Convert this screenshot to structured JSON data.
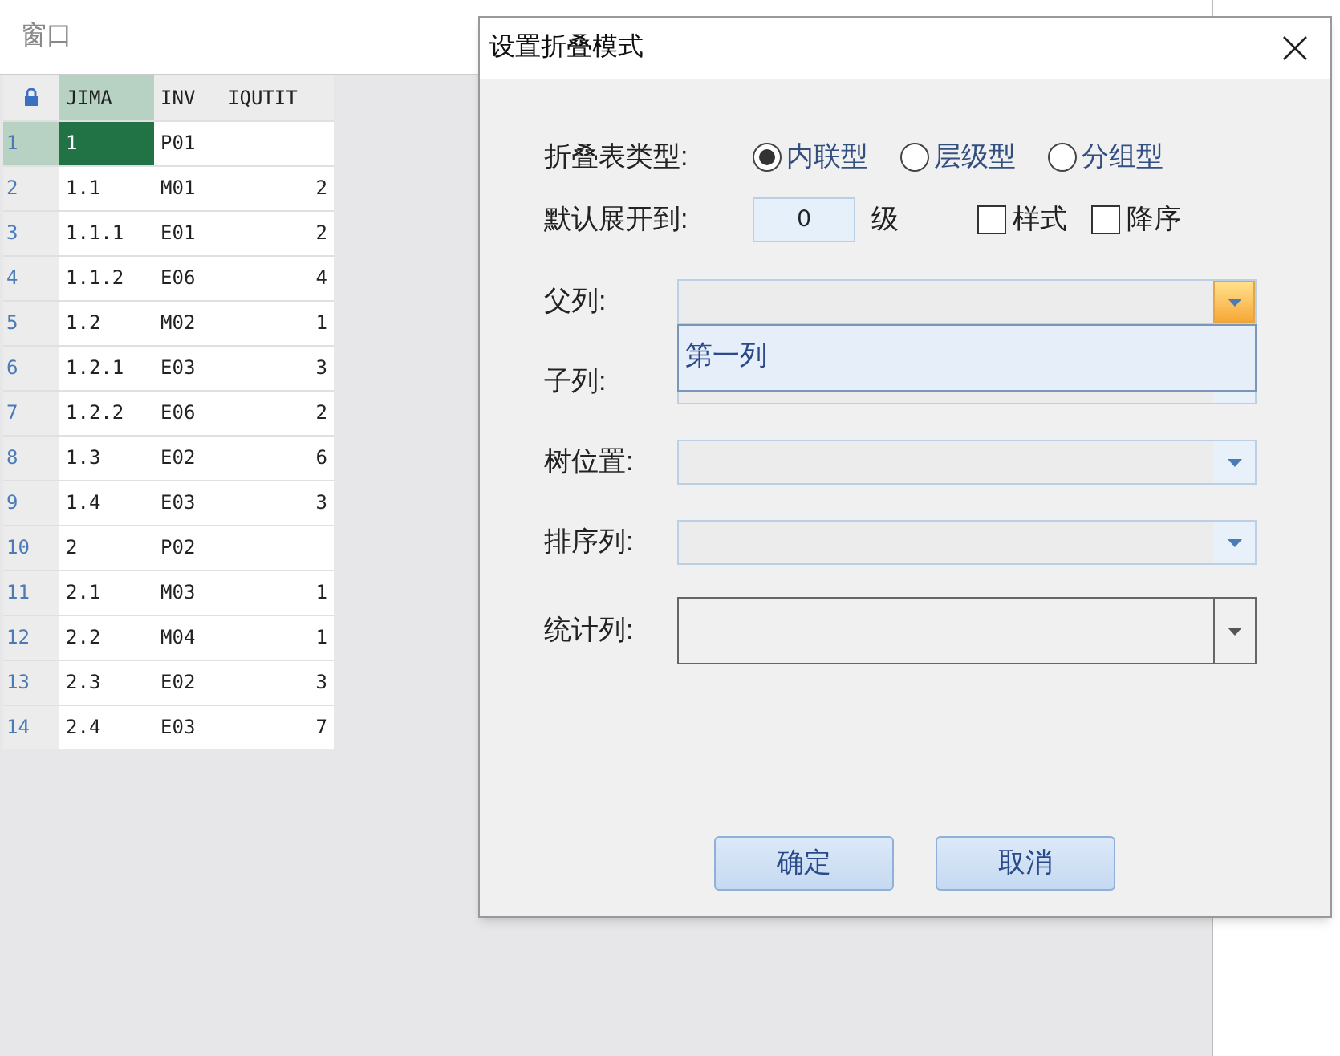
{
  "window": {
    "title": "窗口"
  },
  "table": {
    "columns": [
      "JIMA",
      "INV",
      "IQUTIT"
    ],
    "rows": [
      {
        "number": "1",
        "cells": [
          "1",
          "P01",
          ""
        ],
        "selected": true
      },
      {
        "number": "2",
        "cells": [
          "1.1",
          "M01",
          "2"
        ],
        "selected": false
      },
      {
        "number": "3",
        "cells": [
          "1.1.1",
          "E01",
          "2"
        ],
        "selected": false
      },
      {
        "number": "4",
        "cells": [
          "1.1.2",
          "E06",
          "4"
        ],
        "selected": false
      },
      {
        "number": "5",
        "cells": [
          "1.2",
          "M02",
          "1"
        ],
        "selected": false
      },
      {
        "number": "6",
        "cells": [
          "1.2.1",
          "E03",
          "3"
        ],
        "selected": false
      },
      {
        "number": "7",
        "cells": [
          "1.2.2",
          "E06",
          "2"
        ],
        "selected": false
      },
      {
        "number": "8",
        "cells": [
          "1.3",
          "E02",
          "6"
        ],
        "selected": false
      },
      {
        "number": "9",
        "cells": [
          "1.4",
          "E03",
          "3"
        ],
        "selected": false
      },
      {
        "number": "10",
        "cells": [
          "2",
          "P02",
          ""
        ],
        "selected": false
      },
      {
        "number": "11",
        "cells": [
          "2.1",
          "M03",
          "1"
        ],
        "selected": false
      },
      {
        "number": "12",
        "cells": [
          "2.2",
          "M04",
          "1"
        ],
        "selected": false
      },
      {
        "number": "13",
        "cells": [
          "2.3",
          "E02",
          "3"
        ],
        "selected": false
      },
      {
        "number": "14",
        "cells": [
          "2.4",
          "E03",
          "7"
        ],
        "selected": false
      }
    ]
  },
  "dialog": {
    "title": "设置折叠模式",
    "type_label": "折叠表类型:",
    "radios": [
      {
        "label": "内联型",
        "selected": true
      },
      {
        "label": "层级型",
        "selected": false
      },
      {
        "label": "分组型",
        "selected": false
      }
    ],
    "expand_label": "默认展开到:",
    "expand_value": "0",
    "expand_unit": "级",
    "checkboxes": [
      {
        "label": "样式",
        "checked": false
      },
      {
        "label": "降序",
        "checked": false
      }
    ],
    "fields": [
      {
        "label": "父列:",
        "kind": "light",
        "open": true,
        "options": [
          "第一列"
        ]
      },
      {
        "label": "子列:",
        "kind": "light",
        "open": false
      },
      {
        "label": "树位置:",
        "kind": "light",
        "open": false
      },
      {
        "label": "排序列:",
        "kind": "light",
        "open": false
      },
      {
        "label": "统计列:",
        "kind": "dark",
        "open": false
      }
    ],
    "buttons": [
      "确定",
      "取消"
    ]
  }
}
